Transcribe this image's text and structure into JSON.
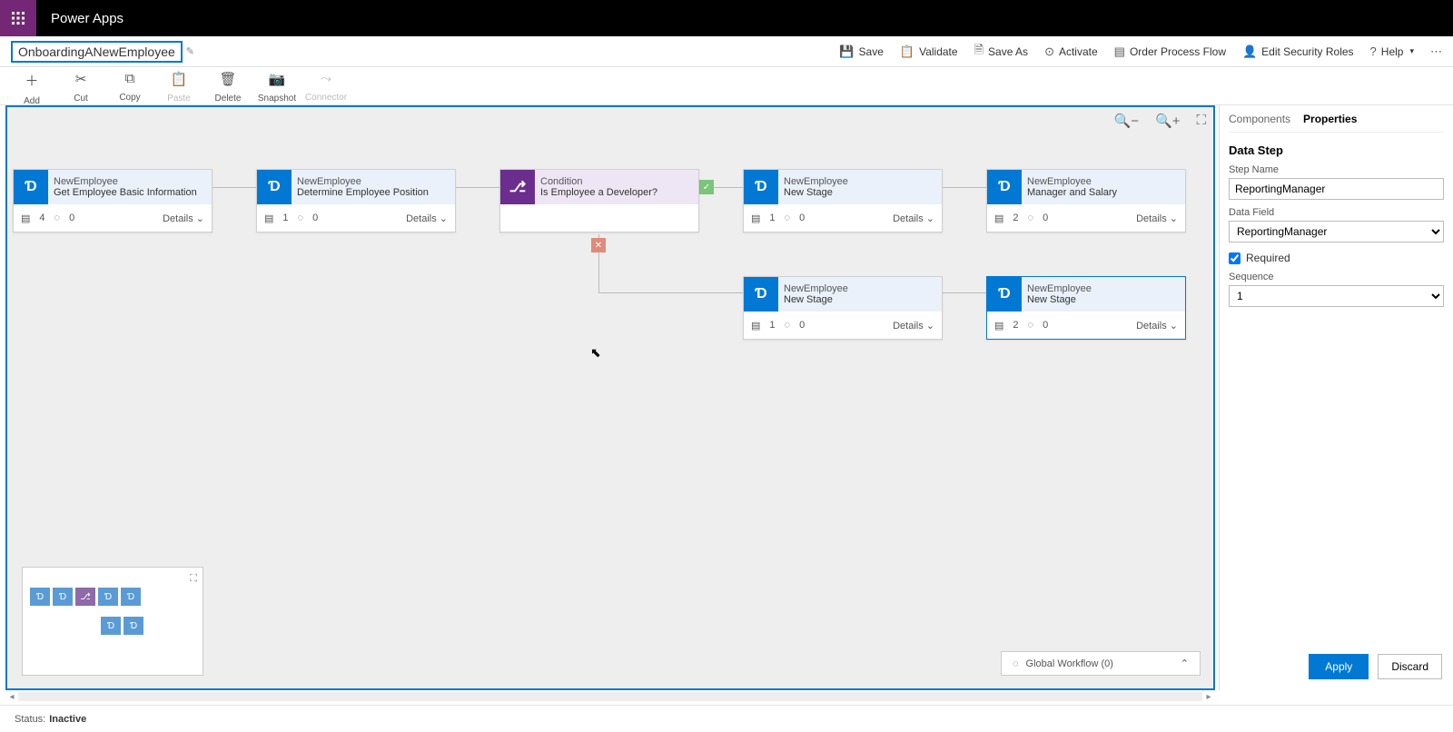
{
  "app": {
    "title": "Power Apps"
  },
  "flow": {
    "name": "OnboardingANewEmployee"
  },
  "headerActions": {
    "save": "Save",
    "validate": "Validate",
    "saveAs": "Save As",
    "activate": "Activate",
    "orderFlow": "Order Process Flow",
    "editSecurity": "Edit Security Roles",
    "help": "Help"
  },
  "toolbar": {
    "add": "Add",
    "cut": "Cut",
    "copy": "Copy",
    "paste": "Paste",
    "delete": "Delete",
    "snapshot": "Snapshot",
    "connector": "Connector"
  },
  "stages": {
    "s1": {
      "entity": "NewEmployee",
      "title": "Get Employee Basic Information",
      "steps": "4",
      "trig": "0",
      "details": "Details"
    },
    "s2": {
      "entity": "NewEmployee",
      "title": "Determine Employee Position",
      "steps": "1",
      "trig": "0",
      "details": "Details"
    },
    "cond": {
      "entity": "Condition",
      "title": "Is Employee a Developer?"
    },
    "s3": {
      "entity": "NewEmployee",
      "title": "New Stage",
      "steps": "1",
      "trig": "0",
      "details": "Details"
    },
    "s4": {
      "entity": "NewEmployee",
      "title": "Manager and Salary",
      "steps": "2",
      "trig": "0",
      "details": "Details"
    },
    "s5": {
      "entity": "NewEmployee",
      "title": "New Stage",
      "steps": "1",
      "trig": "0",
      "details": "Details"
    },
    "s6": {
      "entity": "NewEmployee",
      "title": "New Stage",
      "steps": "2",
      "trig": "0",
      "details": "Details"
    }
  },
  "badges": {
    "yes": "✓",
    "no": "✕"
  },
  "globalWorkflow": "Global Workflow (0)",
  "panel": {
    "tabs": {
      "components": "Components",
      "properties": "Properties"
    },
    "title": "Data Step",
    "stepNameLabel": "Step Name",
    "stepName": "ReportingManager",
    "dataFieldLabel": "Data Field",
    "dataField": "ReportingManager",
    "requiredLabel": "Required",
    "requiredChecked": true,
    "sequenceLabel": "Sequence",
    "sequence": "1",
    "apply": "Apply",
    "discard": "Discard"
  },
  "status": {
    "label": "Status:",
    "value": "Inactive"
  }
}
